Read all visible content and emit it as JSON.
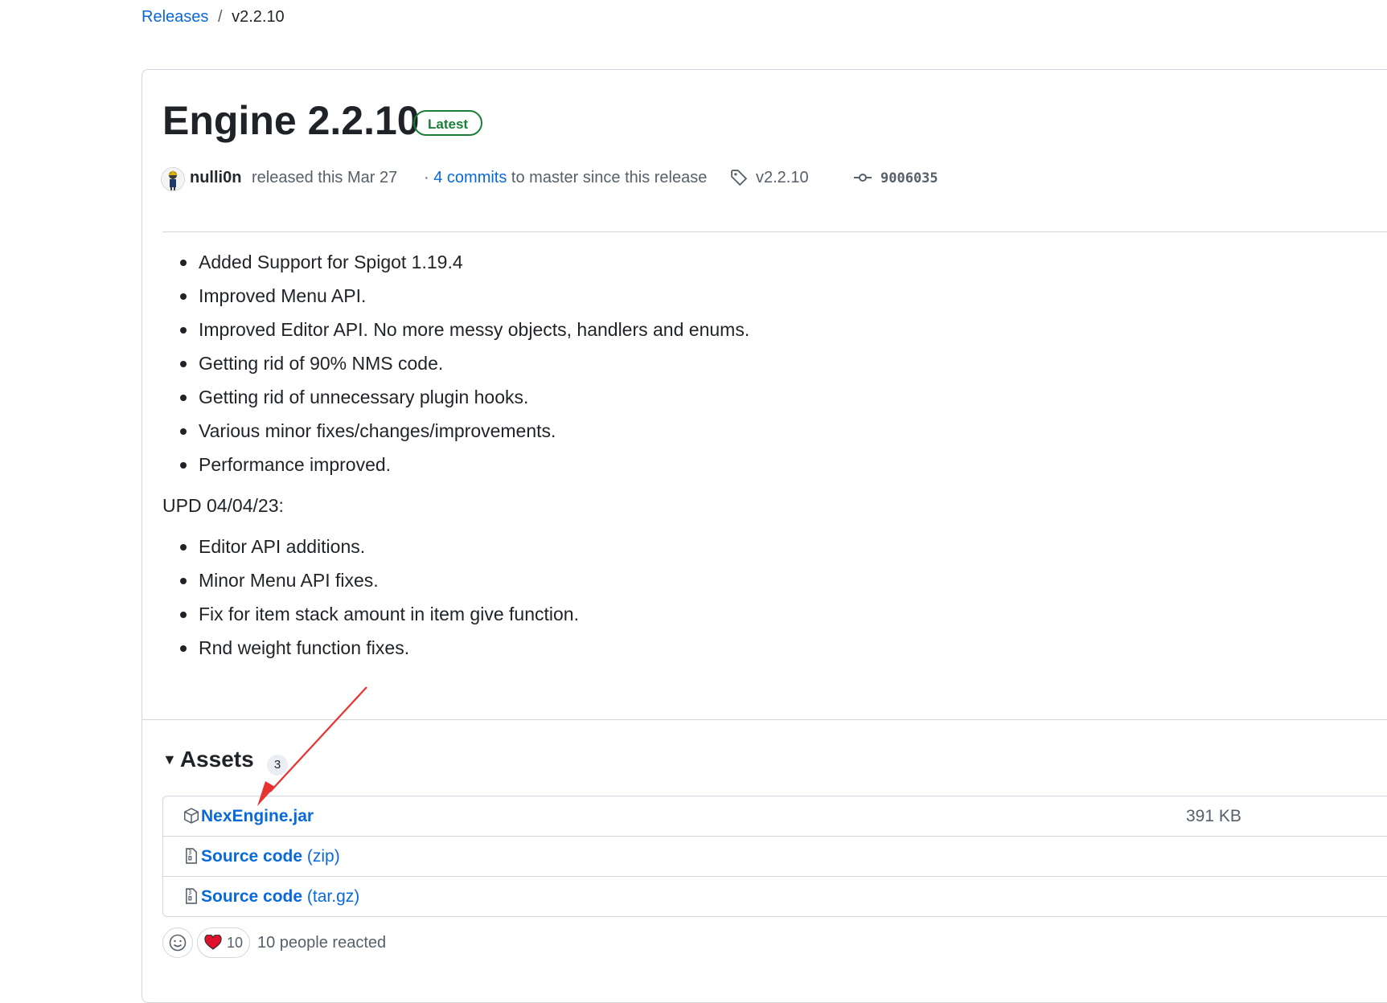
{
  "breadcrumb": {
    "parent": "Releases",
    "separator": "/",
    "current": "v2.2.10"
  },
  "release": {
    "title": "Engine 2.2.10",
    "badge": "Latest",
    "author": "nulli0n",
    "released_text": "released this Mar 27",
    "commits_prefix": "·",
    "commits_link": "4 commits",
    "commits_suffix": "to master since this release",
    "tag": "v2.2.10",
    "commit_sha": "9006035"
  },
  "notes": {
    "list1": [
      "Added Support for Spigot 1.19.4",
      "Improved Menu API.",
      "Improved Editor API. No more messy objects, handlers and enums.",
      "Getting rid of 90% NMS code.",
      "Getting rid of unnecessary plugin hooks.",
      "Various minor fixes/changes/improvements.",
      "Performance improved."
    ],
    "update_heading": "UPD 04/04/23:",
    "list2": [
      "Editor API additions.",
      "Minor Menu API fixes.",
      "Fix for item stack amount in item give function.",
      "Rnd weight function fixes."
    ]
  },
  "assets": {
    "heading": "Assets",
    "count": "3",
    "items": [
      {
        "name": "NexEngine.jar",
        "ext": "",
        "size": "391 KB",
        "icon": "package-icon"
      },
      {
        "name": "Source code",
        "ext": "(zip)",
        "size": "",
        "icon": "file-zip-icon"
      },
      {
        "name": "Source code",
        "ext": "(tar.gz)",
        "size": "",
        "icon": "file-zip-icon"
      }
    ]
  },
  "reactions": {
    "heart_count": "10",
    "summary": "10 people reacted"
  },
  "colors": {
    "link": "#0969da",
    "latest_green": "#1a7f37",
    "annotation_arrow": "#e8322f"
  }
}
